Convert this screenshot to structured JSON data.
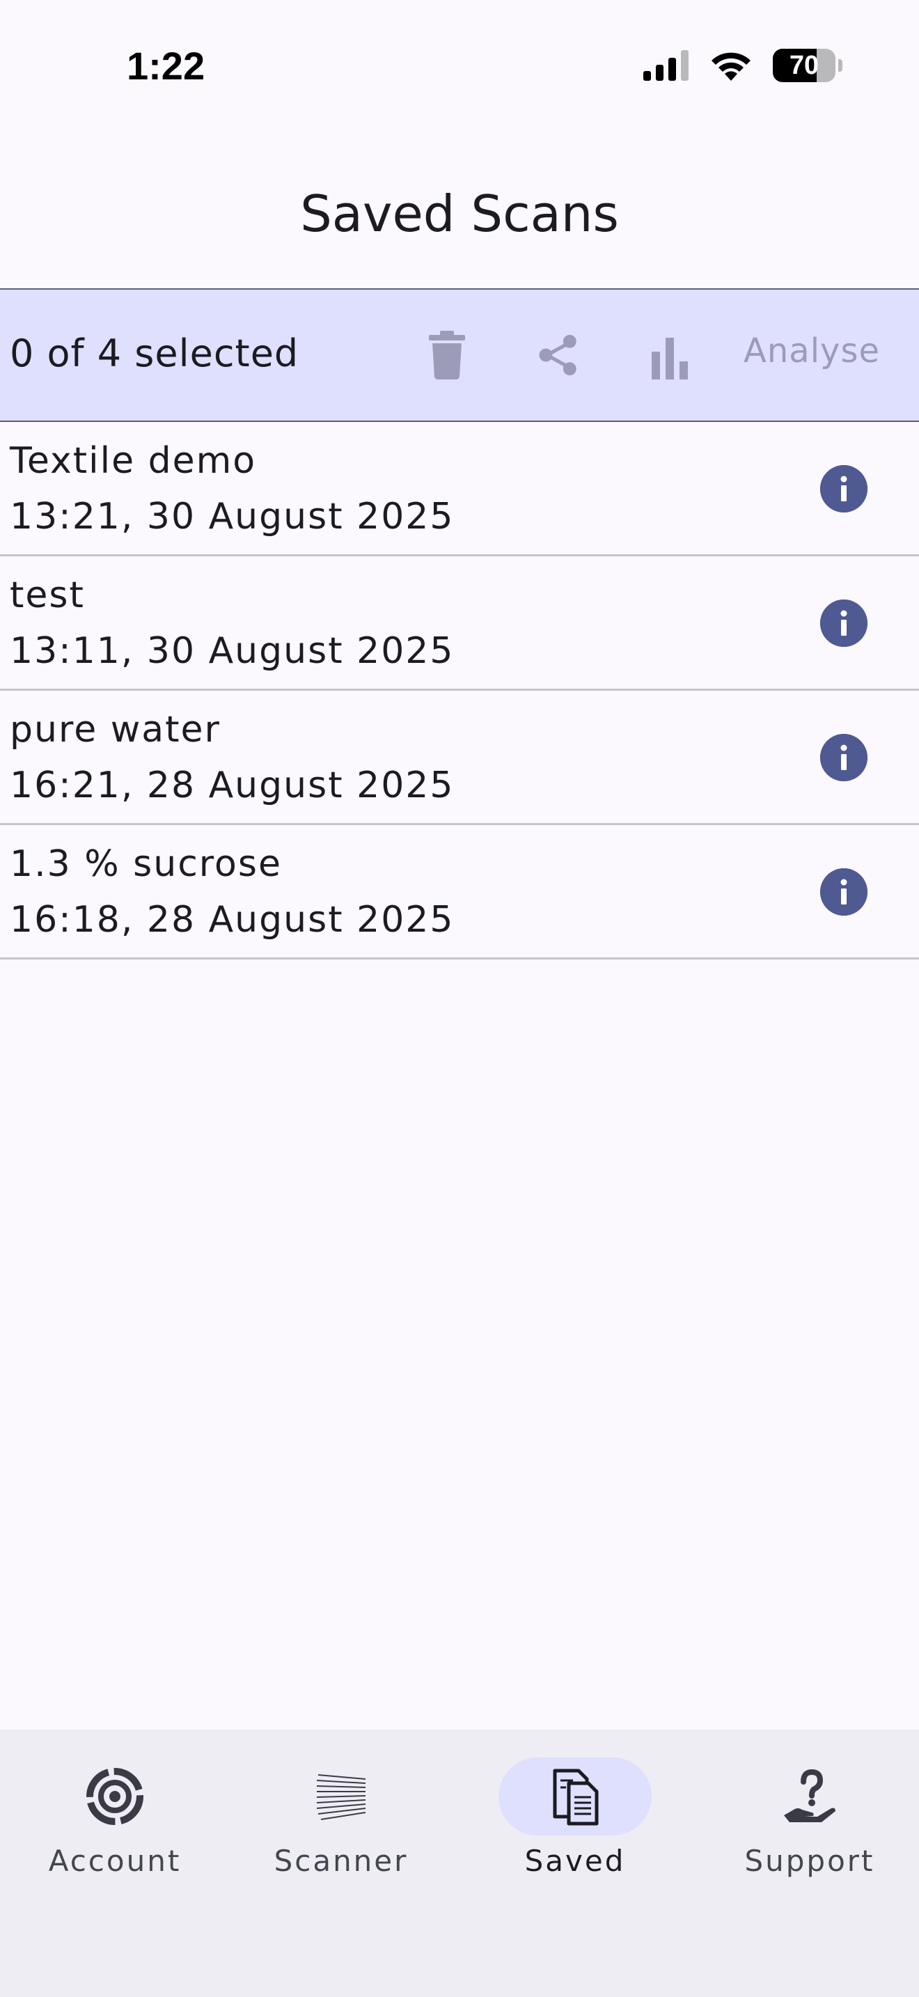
{
  "status": {
    "time": "1:22",
    "battery": "70",
    "battery_level": 0.7
  },
  "header": {
    "title": "Saved Scans"
  },
  "selection_bar": {
    "count_text": "0 of 4 selected",
    "analyse_label": "Analyse",
    "actions": [
      "delete-icon",
      "share-icon",
      "bar-chart-icon"
    ]
  },
  "scans": [
    {
      "name": "Textile demo",
      "date": "13:21, 30 August 2025"
    },
    {
      "name": "test",
      "date": "13:11, 30 August 2025"
    },
    {
      "name": "pure water",
      "date": "16:21, 28 August 2025"
    },
    {
      "name": "1.3 % sucrose",
      "date": "16:18, 28 August 2025"
    }
  ],
  "nav": {
    "items": [
      {
        "label": "Account",
        "icon": "target-icon"
      },
      {
        "label": "Scanner",
        "icon": "scanner-icon"
      },
      {
        "label": "Saved",
        "icon": "document-icon",
        "active": true
      },
      {
        "label": "Support",
        "icon": "help-hand-icon"
      }
    ]
  },
  "colors": {
    "accent": "#4f5992",
    "selection_bg": "#dfe0fe",
    "disabled": "#9c9cb8"
  }
}
